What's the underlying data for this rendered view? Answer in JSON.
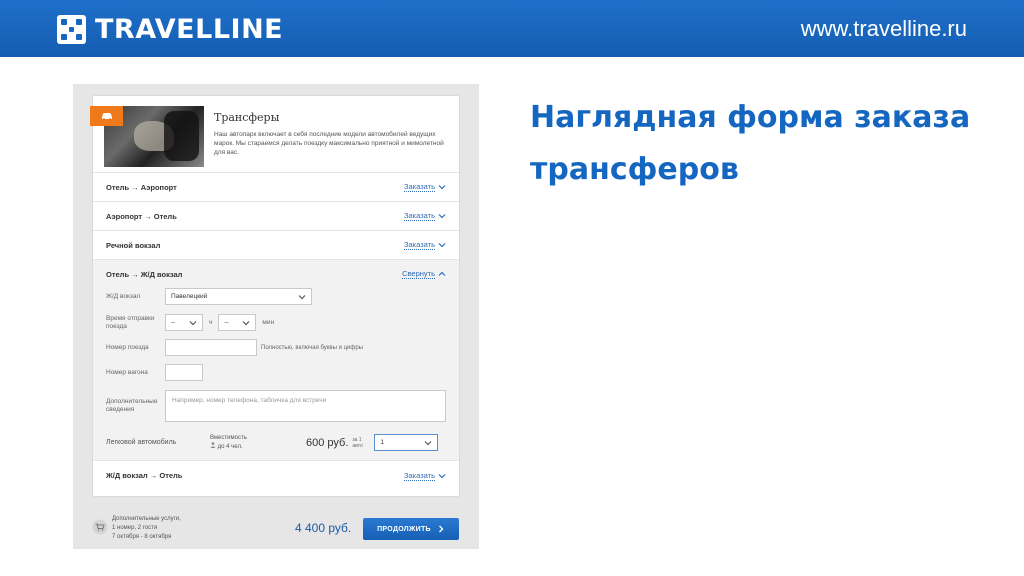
{
  "header": {
    "brand": "TRAVELLINE",
    "site_url": "www.travelline.ru"
  },
  "headline": "Наглядная форма заказа трансферов",
  "card": {
    "title": "Трансферы",
    "description": "Наш автопарк включает в себя последние модели автомобилей ведущих марок. Мы стараемся делать поездку максимально приятной и мимолетной для вас.",
    "order_link": "Заказать",
    "collapse_link": "Свернуть",
    "routes": [
      {
        "label": "Отель → Аэропорт"
      },
      {
        "label": "Аэропорт → Отель"
      },
      {
        "label": "Речной вокзал"
      }
    ],
    "expanded": {
      "label": "Отель → Ж/Д вокзал",
      "station_label": "Ж/Д вокзал",
      "station_value": "Павелецкий",
      "time_label": "Время отправки поезда",
      "hours_value": "--",
      "hours_unit": "ч",
      "minutes_value": "--",
      "minutes_unit": "мин",
      "train_label": "Номер поезда",
      "train_hint": "Полностью, включая буквы и цифры",
      "car_label": "Номер вагона",
      "extra_label": "Дополнительные сведения",
      "extra_placeholder": "Например, номер телефона, табличка для встречи",
      "vehicle": "Легковой автомобиль",
      "capacity_label": "Вместимость",
      "capacity_value": "до 4 чел.",
      "price": "600 руб.",
      "price_per": "за 1 авто",
      "qty_value": "1"
    },
    "last_route": {
      "label": "Ж/Д вокзал → Отель"
    }
  },
  "footer": {
    "services_label": "Дополнительные услуги,",
    "rooms": "1 номер, 2 гостя",
    "dates": "7 октября - 8 октября",
    "total": "4 400 руб.",
    "continue_label": "ПРОДОЛЖИТЬ"
  },
  "colors": {
    "header_blue": "#1866bd",
    "headline_blue": "#1466c0",
    "badge_orange": "#f07a1a",
    "link_blue": "#2d6db8"
  }
}
